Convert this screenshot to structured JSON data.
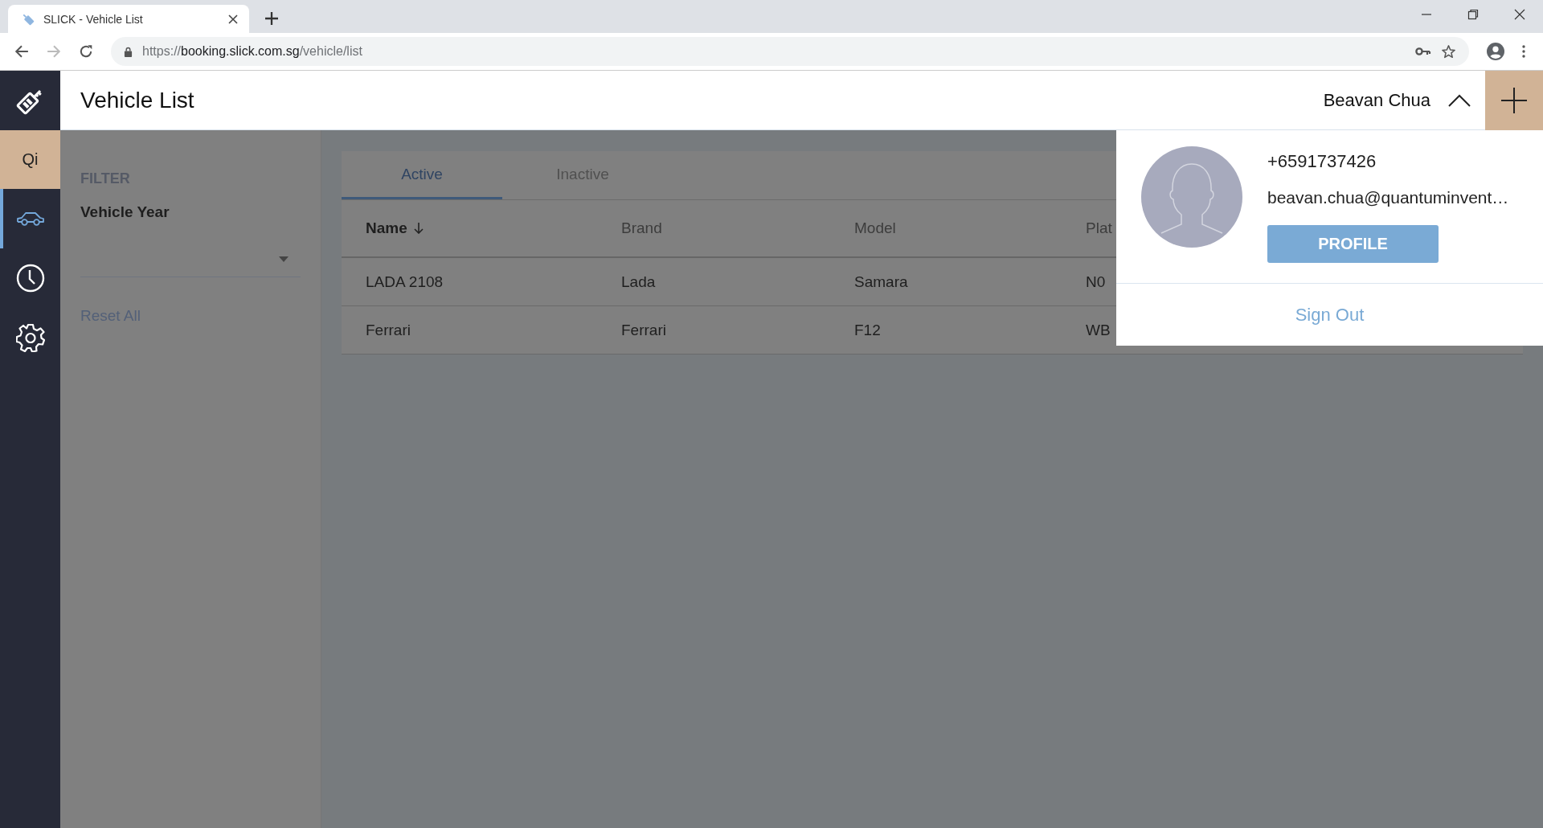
{
  "browser": {
    "tab_title": "SLICK - Vehicle List",
    "url": {
      "scheme": "https://",
      "host": "booking.slick.com.sg",
      "path": "/vehicle/list"
    }
  },
  "sidebar": {
    "workspace": "Qi",
    "items": [
      {
        "kind": "vehicles",
        "selected": true
      },
      {
        "kind": "history",
        "selected": false
      },
      {
        "kind": "settings",
        "selected": false
      }
    ]
  },
  "header": {
    "title": "Vehicle List",
    "user": "Beavan Chua",
    "menu_expanded": true
  },
  "filter": {
    "title": "FILTER",
    "field_label": "Vehicle Year",
    "reset": "Reset All"
  },
  "tabs": [
    {
      "label": "Active",
      "selected": true
    },
    {
      "label": "Inactive",
      "selected": false
    }
  ],
  "table": {
    "columns": [
      {
        "label": "Name",
        "sorted": true
      },
      {
        "label": "Brand",
        "sorted": false
      },
      {
        "label": "Model",
        "sorted": false
      },
      {
        "label": "Plat",
        "sorted": false
      }
    ],
    "rows": [
      [
        "LADA 2108",
        "Lada",
        "Samara",
        "N0"
      ],
      [
        "Ferrari",
        "Ferrari",
        "F12",
        "WB"
      ]
    ]
  },
  "user_menu": {
    "phone": "+6591737426",
    "email": "beavan.chua@quantuminvent…",
    "profile_button": "PROFILE",
    "sign_out": "Sign Out"
  }
}
